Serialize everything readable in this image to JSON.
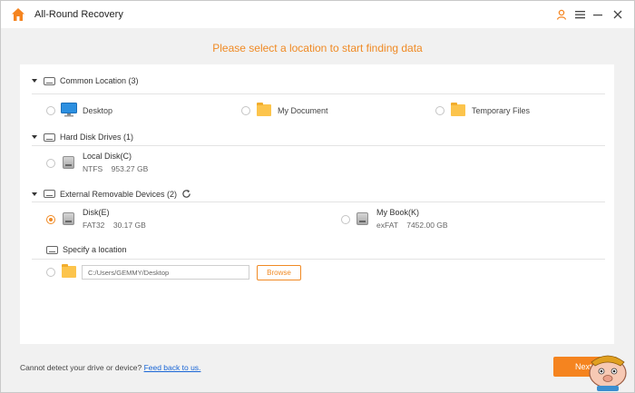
{
  "window": {
    "title": "All-Round Recovery"
  },
  "header": {
    "prompt": "Please select a location to start finding data"
  },
  "sections": {
    "common": {
      "title": "Common Location (3)",
      "items": [
        {
          "label": "Desktop",
          "icon": "desktop-monitor-icon"
        },
        {
          "label": "My Document",
          "icon": "folder-icon"
        },
        {
          "label": "Temporary Files",
          "icon": "folder-icon"
        }
      ]
    },
    "hdd": {
      "title": "Hard Disk Drives (1)",
      "drives": [
        {
          "name": "Local Disk(C)",
          "info": "NTFS    953.27 GB"
        }
      ]
    },
    "external": {
      "title": "External Removable Devices (2)",
      "drives": [
        {
          "name": "Disk(E)",
          "info": "FAT32    30.17 GB",
          "selected": true
        },
        {
          "name": "My Book(K)",
          "info": "exFAT    7452.00 GB",
          "selected": false
        }
      ]
    },
    "specify": {
      "title": "Specify a location",
      "path_value": "C:/Users/GEMMY/Desktop",
      "browse_label": "Browse"
    }
  },
  "footer": {
    "text": "Cannot detect your drive or device?",
    "link": "Feed back to us.",
    "next_label": "Next"
  },
  "colors": {
    "accent": "#f08a24",
    "link": "#1a66d6",
    "folder": "#fcc44c"
  }
}
